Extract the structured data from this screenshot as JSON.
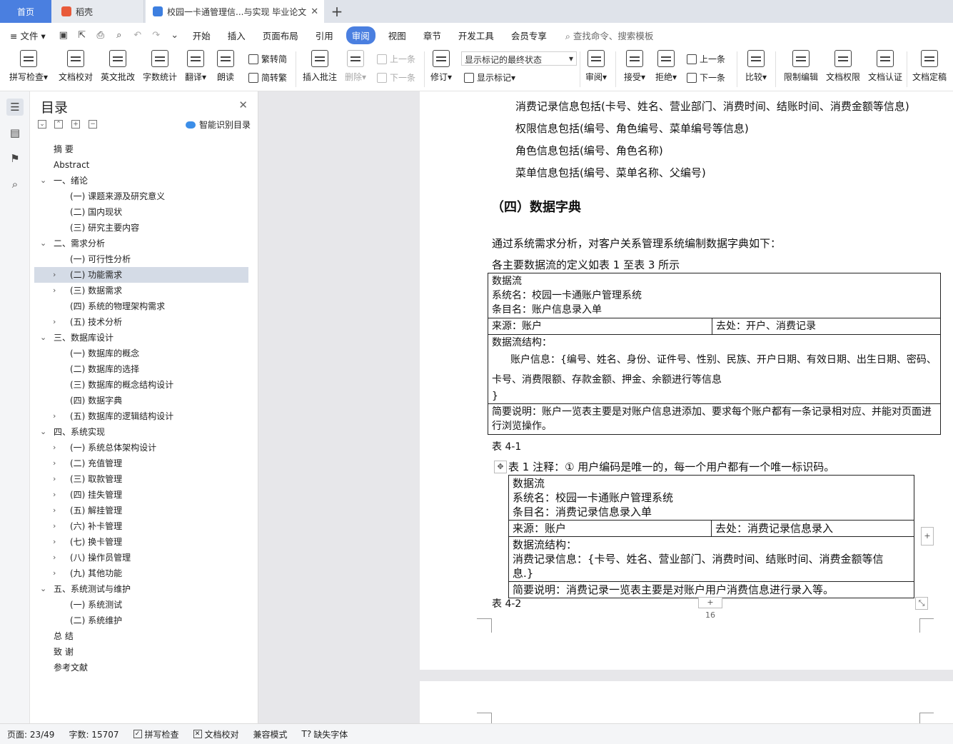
{
  "tabs": {
    "home": "首页",
    "daoke": "稻壳",
    "doc": "校园一卡通管理信...与实现 毕业论文"
  },
  "menu": {
    "file": "文件",
    "items": [
      "开始",
      "插入",
      "页面布局",
      "引用",
      "审阅",
      "视图",
      "章节",
      "开发工具",
      "会员专享"
    ],
    "active": "审阅",
    "search": "查找命令、搜索模板"
  },
  "ribbon": {
    "spell": "拼写检查",
    "proof": "文档校对",
    "eng": "英文批改",
    "wordcount": "字数统计",
    "translate": "翻译",
    "read": "朗读",
    "trad2simp": "繁转简",
    "simp2trad": "简转繁",
    "insert_comment": "插入批注",
    "delete": "删除",
    "prev": "上一条",
    "next": "下一条",
    "revise": "修订",
    "markup_state": "显示标记的最终状态",
    "show_markup": "显示标记",
    "review": "审阅",
    "accept": "接受",
    "reject": "拒绝",
    "prev2": "上一条",
    "next2": "下一条",
    "compare": "比较",
    "restrict": "限制编辑",
    "rights": "文档权限",
    "cert": "文档认证",
    "finalize": "文档定稿"
  },
  "toc": {
    "title": "目录",
    "smart": "智能识别目录",
    "items": [
      {
        "label": "摘  要",
        "level": 0,
        "chev": ""
      },
      {
        "label": "Abstract",
        "level": 0,
        "chev": ""
      },
      {
        "label": "一、绪论",
        "level": 0,
        "chev": "down"
      },
      {
        "label": "(一) 课题来源及研究意义",
        "level": 1,
        "chev": ""
      },
      {
        "label": "(二) 国内现状",
        "level": 1,
        "chev": ""
      },
      {
        "label": "(三) 研究主要内容",
        "level": 1,
        "chev": ""
      },
      {
        "label": "二、需求分析",
        "level": 0,
        "chev": "down"
      },
      {
        "label": "(一) 可行性分析",
        "level": 1,
        "chev": ""
      },
      {
        "label": "(二) 功能需求",
        "level": 1,
        "chev": "right",
        "selected": true
      },
      {
        "label": "(三) 数据需求",
        "level": 1,
        "chev": "right"
      },
      {
        "label": "(四) 系统的物理架构需求",
        "level": 1,
        "chev": ""
      },
      {
        "label": "(五) 技术分析",
        "level": 1,
        "chev": "right"
      },
      {
        "label": "三、数据库设计",
        "level": 0,
        "chev": "down"
      },
      {
        "label": "(一) 数据库的概念",
        "level": 1,
        "chev": ""
      },
      {
        "label": "(二) 数据库的选择",
        "level": 1,
        "chev": ""
      },
      {
        "label": "(三) 数据库的概念结构设计",
        "level": 1,
        "chev": ""
      },
      {
        "label": "(四) 数据字典",
        "level": 1,
        "chev": ""
      },
      {
        "label": "(五) 数据库的逻辑结构设计",
        "level": 1,
        "chev": "right"
      },
      {
        "label": "四、系统实现",
        "level": 0,
        "chev": "down"
      },
      {
        "label": "(一) 系统总体架构设计",
        "level": 1,
        "chev": "right"
      },
      {
        "label": "(二) 充值管理",
        "level": 1,
        "chev": "right"
      },
      {
        "label": "(三) 取款管理",
        "level": 1,
        "chev": "right"
      },
      {
        "label": "(四) 挂失管理",
        "level": 1,
        "chev": "right"
      },
      {
        "label": "(五) 解挂管理",
        "level": 1,
        "chev": "right"
      },
      {
        "label": "(六) 补卡管理",
        "level": 1,
        "chev": "right"
      },
      {
        "label": "(七) 换卡管理",
        "level": 1,
        "chev": "right"
      },
      {
        "label": "(八) 操作员管理",
        "level": 1,
        "chev": "right"
      },
      {
        "label": "(九) 其他功能",
        "level": 1,
        "chev": "right"
      },
      {
        "label": "五、系统测试与维护",
        "level": 0,
        "chev": "down"
      },
      {
        "label": "(一) 系统测试",
        "level": 1,
        "chev": ""
      },
      {
        "label": "(二) 系统维护",
        "level": 1,
        "chev": ""
      },
      {
        "label": "总  结",
        "level": 0,
        "chev": ""
      },
      {
        "label": "致  谢",
        "level": 0,
        "chev": ""
      },
      {
        "label": "参考文献",
        "level": 0,
        "chev": ""
      }
    ]
  },
  "doc": {
    "lines": [
      "消费记录信息包括(卡号、姓名、营业部门、消费时间、结账时间、消费金额等信息)",
      "权限信息包括(编号、角色编号、菜单编号等信息)",
      "角色信息包括(编号、角色名称)",
      "菜单信息包括(编号、菜单名称、父编号)"
    ],
    "heading": "（四）数据字典",
    "intro1": "通过系统需求分析，对客户关系管理系统编制数据字典如下：",
    "intro2": "各主要数据流的定义如表 1 至表 3 所示",
    "t1": {
      "r1a": "数据流",
      "r1b": "系统名：校园一卡通账户管理系统",
      "r1c": "条目名：账户信息录入单",
      "src": "来源：账户",
      "dst": "去处：开户、消费记录",
      "struct": "数据流结构：",
      "body1": "账户信息：{编号、姓名、身份、证件号、性别、民族、开户日期、有效日期、出生日期、密码、",
      "body2": "卡号、消费限额、存款金额、押金、余额进行等信息",
      "body3": "}",
      "desc1": "简要说明：账户一览表主要是对账户信息进添加、要求每个账户都有一条记录相对应、并能对页面进",
      "desc2": "行浏览操作。"
    },
    "caption1": "表 4-1",
    "note": "表 1 注释：① 用户编码是唯一的，每一个用户都有一个唯一标识码。",
    "t2": {
      "r1a": "数据流",
      "r1b": "系统名：校园一卡通账户管理系统",
      "r1c": "条目名：消费记录信息录入单",
      "src": "来源：账户",
      "dst": "去处：消费记录信息录入",
      "struct": "数据流结构：",
      "body1": "消费记录信息：{卡号、姓名、营业部门、消费时间、结账时间、消费金额等信",
      "body2": "息.}",
      "desc": "简要说明：消费记录一览表主要是对账户用户消费信息进行录入等。"
    },
    "caption2": "表 4-2",
    "page_number": "16"
  },
  "status": {
    "page": "页面: 23/49",
    "words": "字数: 15707",
    "spell": "拼写检查",
    "proof": "文档校对",
    "compat": "兼容模式",
    "missing_font": "缺失字体"
  }
}
